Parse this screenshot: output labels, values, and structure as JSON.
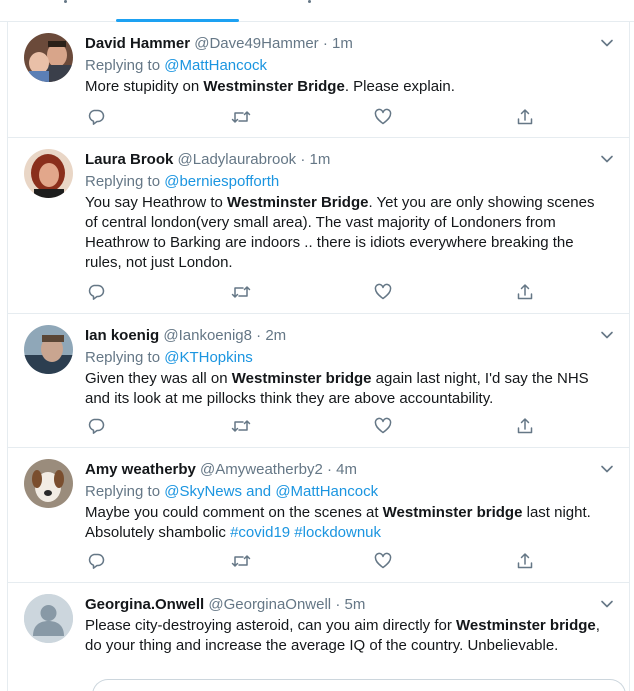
{
  "colors": {
    "accent": "#1da1f2",
    "link": "#1b95e0",
    "secondary_text": "#657786",
    "primary_text": "#14171a",
    "border": "#e6ecf0"
  },
  "tweets": [
    {
      "name": "David Hammer",
      "handle": "@Dave49Hammer",
      "separator": "·",
      "time": "1m",
      "replying_prefix": "Replying to",
      "replying_to": "@MattHancock",
      "body": [
        {
          "text": "More stupidity on "
        },
        {
          "text": "Westminster Bridge",
          "bold": true
        },
        {
          "text": ". Please explain."
        }
      ]
    },
    {
      "name": "Laura Brook",
      "handle": "@Ladylaurabrook",
      "separator": "·",
      "time": "1m",
      "replying_prefix": "Replying to",
      "replying_to": "@berniespofforth",
      "body": [
        {
          "text": "You say Heathrow to "
        },
        {
          "text": "Westminster Bridge",
          "bold": true
        },
        {
          "text": ". Yet you are only showing scenes of central london(very small area). The vast majority of Londoners from Heathrow to Barking are indoors .. there is idiots everywhere breaking the rules, not just London."
        }
      ]
    },
    {
      "name": "Ian koenig",
      "handle": "@Iankoenig8",
      "separator": "·",
      "time": "2m",
      "replying_prefix": "Replying to",
      "replying_to": "@KTHopkins",
      "body": [
        {
          "text": "Given they was all on "
        },
        {
          "text": "Westminster bridge",
          "bold": true
        },
        {
          "text": " again last night, I'd say the NHS and its look at me pillocks think they are above accountability."
        }
      ]
    },
    {
      "name": "Amy weatherby",
      "handle": "@Amyweatherby2",
      "separator": "·",
      "time": "4m",
      "replying_prefix": "Replying to",
      "replying_to": "@SkyNews and @MattHancock",
      "body": [
        {
          "text": "Maybe you could comment on the scenes at "
        },
        {
          "text": "Westminster bridge",
          "bold": true
        },
        {
          "text": " last night. Absolutely shambolic "
        },
        {
          "text": "#covid19",
          "link": true
        },
        {
          "text": " "
        },
        {
          "text": "#lockdownuk",
          "link": true
        }
      ]
    },
    {
      "name": "Georgina.Onwell",
      "handle": "@GeorginaOnwell",
      "separator": "·",
      "time": "5m",
      "replying_prefix": "",
      "replying_to": "",
      "body": [
        {
          "text": "Please city-destroying asteroid, can you aim directly for "
        },
        {
          "text": "Westminster bridge",
          "bold": true
        },
        {
          "text": ", do your thing and increase the average IQ of the country. Unbelievable."
        }
      ]
    }
  ],
  "icons": [
    "reply-icon",
    "retweet-icon",
    "like-icon",
    "share-icon",
    "chevron-down-icon"
  ]
}
